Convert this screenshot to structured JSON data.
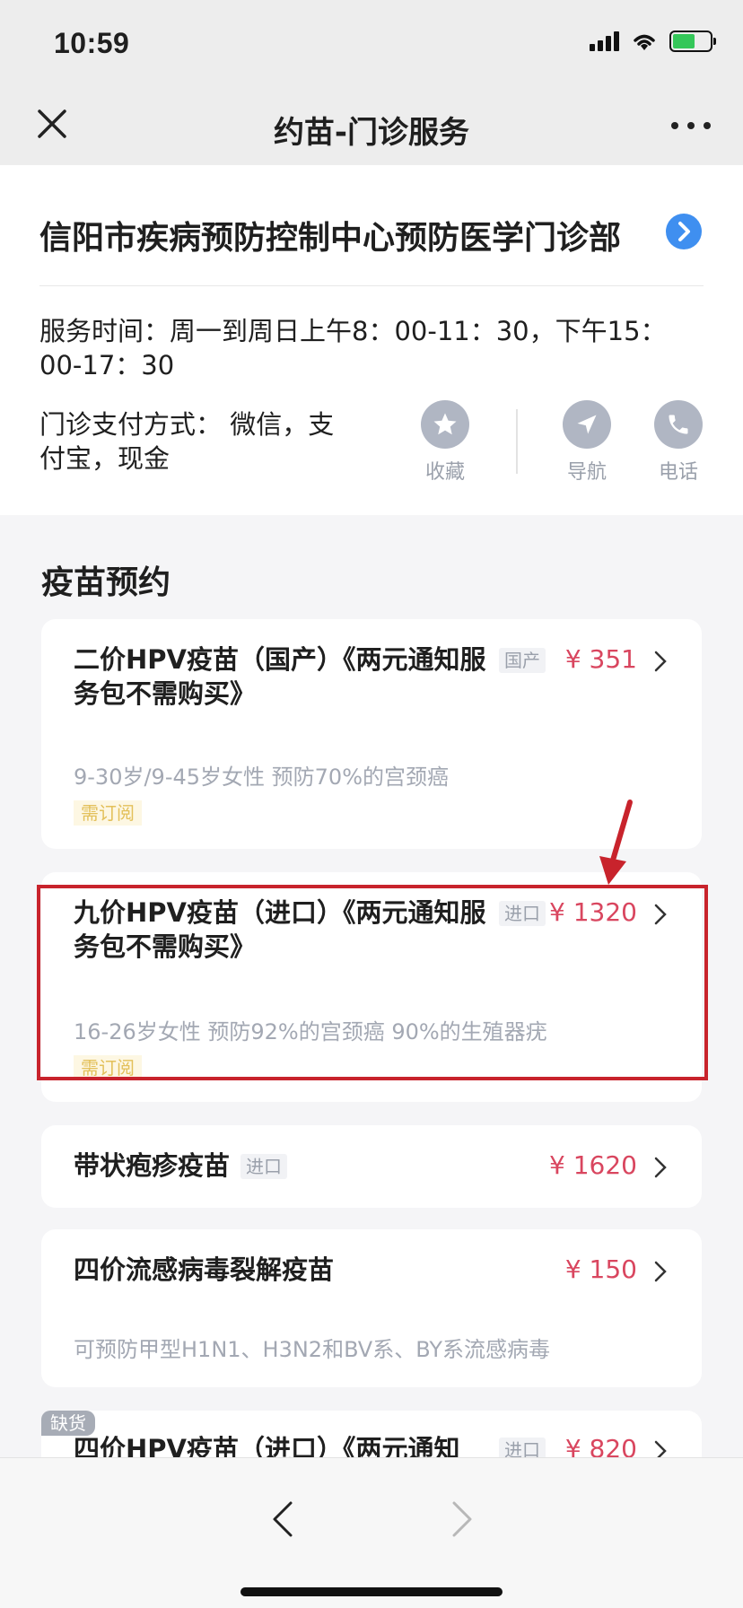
{
  "status_bar": {
    "time": "10:59",
    "battery_color": "#34c759"
  },
  "nav": {
    "title": "约苗-门诊服务",
    "close_icon": "close-icon",
    "more_icon": "more-icon"
  },
  "clinic": {
    "name": "信阳市疾病预防控制中心预防医学门诊部",
    "hours": "服务时间：周一到周日上午8：00-11：30，下午15：00-17：30",
    "payment": "门诊支付方式： 微信，支付宝，现金",
    "actions": [
      {
        "label": "收藏",
        "icon": "star-icon"
      },
      {
        "label": "导航",
        "icon": "navigation-icon"
      },
      {
        "label": "电话",
        "icon": "phone-icon"
      }
    ]
  },
  "section": {
    "title": "疫苗预约"
  },
  "vaccines": [
    {
      "title": "二价HPV疫苗（国产）《两元通知服务包不需购买》",
      "tag": "国产",
      "price": "¥ 351",
      "desc": "9-30岁/9-45岁女性 预防70%的宫颈癌",
      "sub_tag": "需订阅"
    },
    {
      "title": "九价HPV疫苗（进口）《两元通知服务包不需购买》",
      "tag": "进口",
      "price": "¥ 1320",
      "desc": "16-26岁女性 预防92%的宫颈癌 90%的生殖器疣",
      "sub_tag": "需订阅"
    },
    {
      "title": "带状疱疹疫苗",
      "tag": "进口",
      "price": "¥ 1620"
    },
    {
      "title": "四价流感病毒裂解疫苗",
      "price": "¥ 150",
      "desc": "可预防甲型H1N1、H3N2和BV系、BY系流感病毒"
    },
    {
      "title": "四价HPV疫苗（进口）《两元通知",
      "tag": "进口",
      "price": "¥ 820",
      "stock_tag": "缺货"
    }
  ],
  "colors": {
    "accent_price": "#d9465f",
    "highlight": "#c8232c",
    "link_blue": "#3f8ff0"
  }
}
